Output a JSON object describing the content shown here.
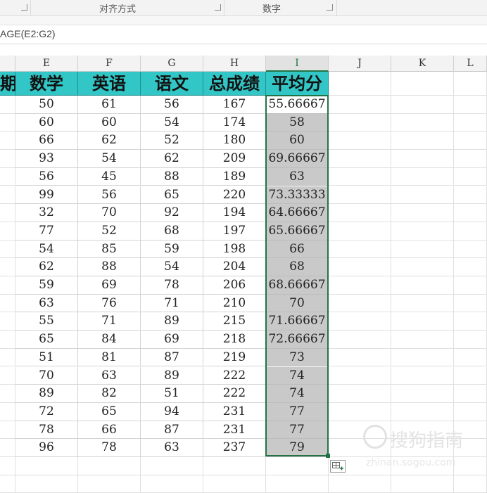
{
  "ribbon": {
    "groups": [
      {
        "label": ""
      },
      {
        "label": "对齐方式"
      },
      {
        "label": "数字"
      }
    ]
  },
  "formula_bar": {
    "text": "AGE(E2:G2)"
  },
  "columns": [
    "E",
    "F",
    "G",
    "H",
    "I",
    "J",
    "K",
    "L"
  ],
  "selected_column": "I",
  "header_row": {
    "d": "期",
    "e": "数学",
    "f": "英语",
    "g": "语文",
    "h": "总成绩",
    "i": "平均分"
  },
  "rows": [
    {
      "e": "50",
      "f": "61",
      "g": "56",
      "h": "167",
      "i": "55.66667"
    },
    {
      "e": "60",
      "f": "60",
      "g": "54",
      "h": "174",
      "i": "58"
    },
    {
      "e": "66",
      "f": "62",
      "g": "52",
      "h": "180",
      "i": "60"
    },
    {
      "e": "93",
      "f": "54",
      "g": "62",
      "h": "209",
      "i": "69.66667"
    },
    {
      "e": "56",
      "f": "45",
      "g": "88",
      "h": "189",
      "i": "63"
    },
    {
      "e": "99",
      "f": "56",
      "g": "65",
      "h": "220",
      "i": "73.33333"
    },
    {
      "e": "32",
      "f": "70",
      "g": "92",
      "h": "194",
      "i": "64.66667"
    },
    {
      "e": "77",
      "f": "52",
      "g": "68",
      "h": "197",
      "i": "65.66667"
    },
    {
      "e": "54",
      "f": "85",
      "g": "59",
      "h": "198",
      "i": "66"
    },
    {
      "e": "62",
      "f": "88",
      "g": "54",
      "h": "204",
      "i": "68"
    },
    {
      "e": "59",
      "f": "69",
      "g": "78",
      "h": "206",
      "i": "68.66667"
    },
    {
      "e": "63",
      "f": "76",
      "g": "71",
      "h": "210",
      "i": "70"
    },
    {
      "e": "55",
      "f": "71",
      "g": "89",
      "h": "215",
      "i": "71.66667"
    },
    {
      "e": "65",
      "f": "84",
      "g": "69",
      "h": "218",
      "i": "72.66667"
    },
    {
      "e": "51",
      "f": "81",
      "g": "87",
      "h": "219",
      "i": "73"
    },
    {
      "e": "70",
      "f": "63",
      "g": "89",
      "h": "222",
      "i": "74"
    },
    {
      "e": "89",
      "f": "82",
      "g": "51",
      "h": "222",
      "i": "74"
    },
    {
      "e": "72",
      "f": "65",
      "g": "94",
      "h": "231",
      "i": "77"
    },
    {
      "e": "78",
      "f": "66",
      "g": "87",
      "h": "231",
      "i": "77"
    },
    {
      "e": "96",
      "f": "78",
      "g": "63",
      "h": "237",
      "i": "79"
    }
  ],
  "watermark": {
    "main": "搜狗指南",
    "sub": "zhinan.sogou.com"
  },
  "colors": {
    "header_fill": "#33c6c6",
    "selection": "#217346",
    "avg_fill": "#c9c9c9"
  }
}
